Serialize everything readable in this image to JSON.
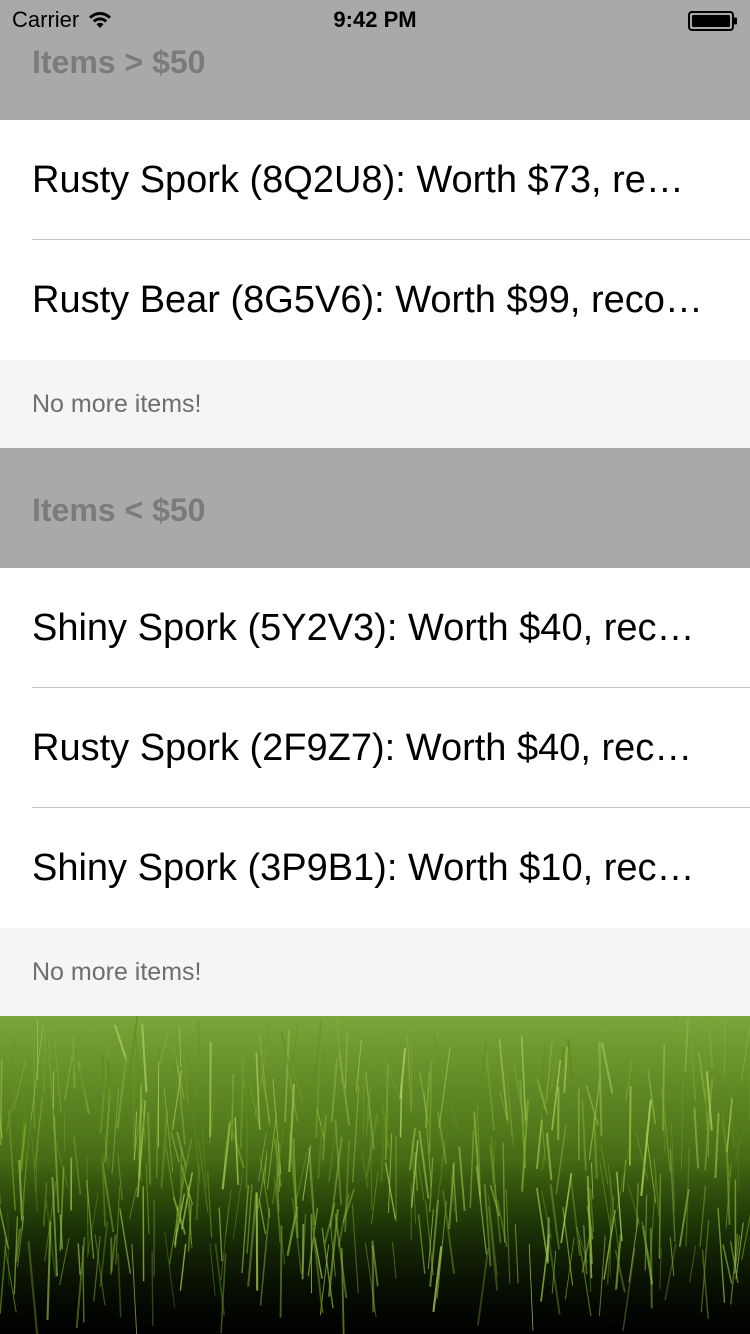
{
  "status_bar": {
    "carrier": "Carrier",
    "time": "9:42 PM",
    "wifi_icon": "wifi-icon",
    "battery_icon": "battery-icon"
  },
  "sections": [
    {
      "header": "Items > $50",
      "rows": [
        "Rusty Spork (8Q2U8): Worth $73, re…",
        "Rusty Bear (8G5V6): Worth $99, reco…"
      ],
      "footer": "No more items!"
    },
    {
      "header": "Items < $50",
      "rows": [
        "Shiny Spork (5Y2V3): Worth $40, rec…",
        "Rusty Spork (2F9Z7): Worth $40, rec…",
        "Shiny Spork (3P9B1): Worth $10, rec…"
      ],
      "footer": "No more items!"
    }
  ],
  "colors": {
    "header_bg": "#a9a9a9",
    "header_text": "#7b7b7b",
    "footer_bg": "#f5f5f5",
    "footer_text": "#6d6d72",
    "separator": "#c8c7cc"
  },
  "background_image": "grass"
}
